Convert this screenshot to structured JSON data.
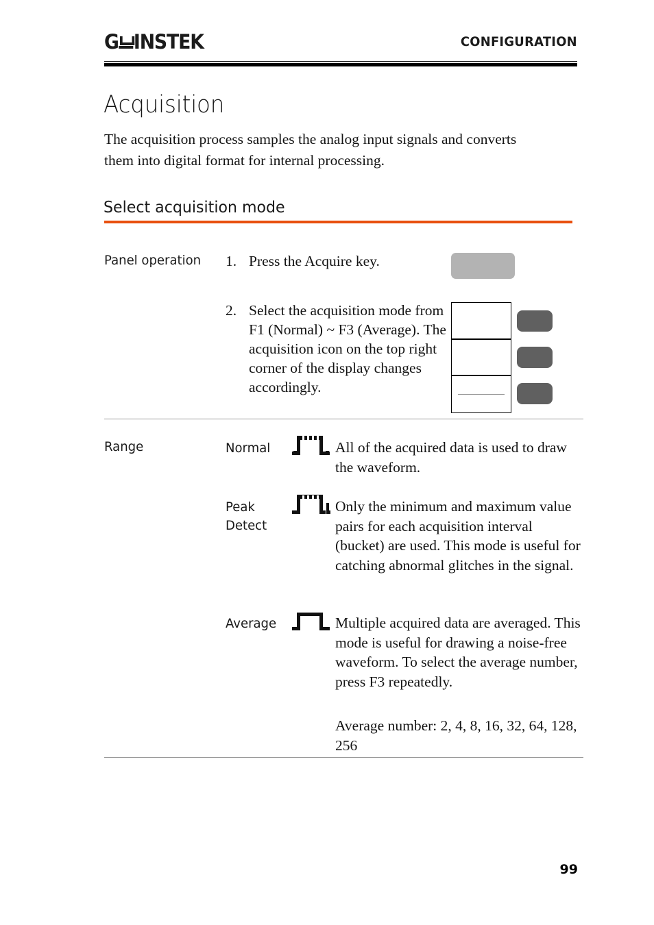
{
  "header": {
    "logo_text_1": "G",
    "logo_text_2": "INSTEK",
    "running_head": "CONFIGURATION"
  },
  "title": "Acquisition",
  "intro": "The acquisition process samples the analog input signals and converts them into digital format for internal processing.",
  "section": {
    "heading": "Select acquisition mode",
    "accent_color": "#e8500f"
  },
  "panel_operation": {
    "label": "Panel operation",
    "steps": [
      {
        "number": "1.",
        "text": "Press the Acquire key."
      },
      {
        "number": "2.",
        "text": "Select the acquisition mode from F1 (Normal) ~ F3 (Average). The acquisition icon on the top right corner of the display changes accordingly."
      }
    ],
    "acquire_key_color": "#b3b3b3",
    "function_key_color": "#606060"
  },
  "range": {
    "label": "Range",
    "modes": [
      {
        "name": "Normal",
        "icon": "normal-waveform-icon",
        "description": "All of the acquired data is used to draw the waveform."
      },
      {
        "name": "Peak Detect",
        "icon": "peak-detect-waveform-icon",
        "description": "Only the minimum and maximum value pairs for each acquisition interval (bucket) are used. This mode is useful for catching abnormal glitches in the signal."
      },
      {
        "name": "Average",
        "icon": "average-waveform-icon",
        "description": "Multiple acquired data are averaged. This mode is useful for drawing a noise-free waveform. To select the average number, press F3 repeatedly.",
        "extra": "Average number: 2, 4, 8, 16, 32, 64, 128, 256"
      }
    ]
  },
  "footer": {
    "page_number": "99"
  }
}
